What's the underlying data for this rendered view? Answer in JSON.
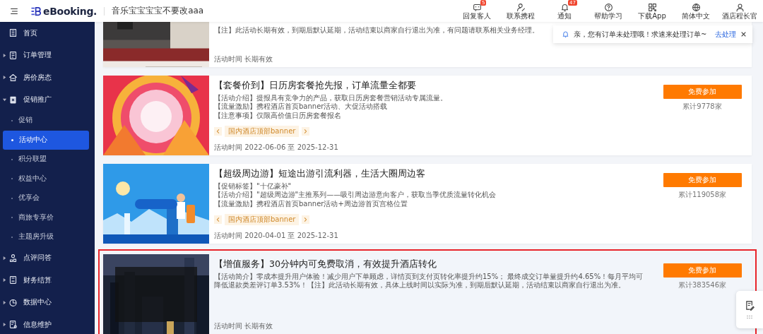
{
  "header": {
    "logo_text": "eBooking.",
    "hotel_name": "音乐宝宝宝宝不要改aaa",
    "nav": [
      {
        "label": "回复客人",
        "badge": "5"
      },
      {
        "label": "联系携程"
      },
      {
        "label": "通知",
        "badge": "47"
      },
      {
        "label": "帮助学习"
      },
      {
        "label": "下载App"
      },
      {
        "label": "简体中文"
      },
      {
        "label": "酒店程长官"
      }
    ]
  },
  "sidebar": {
    "items": [
      {
        "label": "首页",
        "selected": false
      },
      {
        "label": "订单管理",
        "expanded": false,
        "selected": false
      },
      {
        "label": "房价房态",
        "expanded": false,
        "selected": false
      },
      {
        "label": "促销推广",
        "expanded": true,
        "selected": false,
        "children": [
          {
            "label": "促销",
            "selected": false
          },
          {
            "label": "活动中心",
            "selected": true
          },
          {
            "label": "积分联盟",
            "selected": false
          },
          {
            "label": "权益中心",
            "selected": false
          },
          {
            "label": "优享会",
            "selected": false
          },
          {
            "label": "商旅专享价",
            "selected": false
          },
          {
            "label": "主题房升级",
            "selected": false
          }
        ]
      },
      {
        "label": "点评问答",
        "expanded": false,
        "selected": false
      },
      {
        "label": "财务结算",
        "expanded": false,
        "selected": false
      },
      {
        "label": "数据中心",
        "expanded": false,
        "selected": false
      },
      {
        "label": "信息维护",
        "expanded": false,
        "selected": false
      }
    ]
  },
  "notice": {
    "text": "亲，您有订单未处理哦！求速来处理订单~",
    "action": "去处理"
  },
  "cards": [
    {
      "image": {
        "kind": "picture"
      },
      "lines": [
        "【注】此活动长期有效，到期后默认延期，活动结束以商家自行退出为准，有问题请联系相关业务经理。"
      ],
      "time": "活动时间 长期有效",
      "highlighted": false
    },
    {
      "image": {
        "kind": "picture"
      },
      "title": "【套餐价到】日历房套餐抢先报，订单流量全都要",
      "lines": [
        "【活动介绍】提报具有竞争力的产品，获取日历房套餐营销活动专属流量。",
        "【流量激励】携程酒店首页banner活动、大促活动搭载",
        "【注意事项】仅限高价值日历房套餐报名"
      ],
      "tag": "国内酒店顶部banner",
      "time": "活动时间 2022-06-06 至 2025-12-31",
      "button": "免费参加",
      "count": "累计9778家",
      "highlighted": false
    },
    {
      "image": {
        "kind": "picture"
      },
      "title": "【超级周边游】短途出游引流利器，生活大圈周边客",
      "lines": [
        "【促销标签】\"十亿豪补\"",
        "【活动介绍】\"超级周边游\"主推系列——吸引周边游意向客户，获取当季优质流量转化机会",
        "【流量激励】携程酒店首页banner活动+周边游首页宫格位置"
      ],
      "tag": "国内酒店顶部banner",
      "time": "活动时间 2020-04-01 至 2025-12-31",
      "button": "免费参加",
      "count": "累计119058家",
      "highlighted": false
    },
    {
      "image": {
        "kind": "picture"
      },
      "title": "【增值服务】30分钟内可免费取消，有效提升酒店转化",
      "lines": [
        "【活动简介】零成本提升用户体验！减少用户下单顾虑，详情页到支付页转化率提升约15%； 最终成交订单量提升约4.65%！每月平均可降低退款类差评订单3.53%！【注】此活动长期有效，具体上线时间以实际为准，到期后默认延期，活动结束以商家自行退出为准。"
      ],
      "time": "活动时间 长期有效",
      "button": "免费参加",
      "count": "累计383546家",
      "highlighted": true
    }
  ]
}
